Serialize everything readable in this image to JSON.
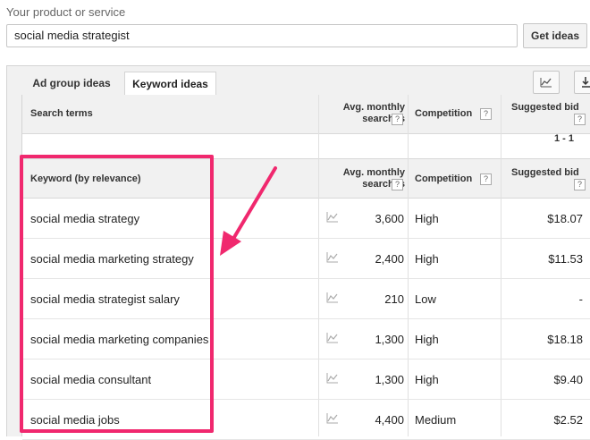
{
  "form": {
    "label": "Your product or service",
    "search_value": "social media strategist",
    "button": "Get ideas"
  },
  "tabs": [
    {
      "label": "Ad group ideas",
      "active": false
    },
    {
      "label": "Keyword ideas",
      "active": true
    }
  ],
  "search_terms_header": {
    "col_term": "Search terms",
    "col_searches": "Avg. monthly searches",
    "col_competition": "Competition",
    "col_bid": "Suggested bid",
    "pager": "1 - 1"
  },
  "keywords_header": {
    "col_term": "Keyword (by relevance)",
    "col_searches": "Avg. monthly searches",
    "col_competition": "Competition",
    "col_bid": "Suggested bid"
  },
  "help_glyph": "?",
  "rows": [
    {
      "keyword": "social media strategy",
      "searches": "3,600",
      "competition": "High",
      "bid": "$18.07"
    },
    {
      "keyword": "social media marketing strategy",
      "searches": "2,400",
      "competition": "High",
      "bid": "$11.53"
    },
    {
      "keyword": "social media strategist salary",
      "searches": "210",
      "competition": "Low",
      "bid": "-"
    },
    {
      "keyword": "social media marketing companies",
      "searches": "1,300",
      "competition": "High",
      "bid": "$18.18"
    },
    {
      "keyword": "social media consultant",
      "searches": "1,300",
      "competition": "High",
      "bid": "$9.40"
    },
    {
      "keyword": "social media jobs",
      "searches": "4,400",
      "competition": "Medium",
      "bid": "$2.52"
    }
  ],
  "colors": {
    "highlight": "#f0286e",
    "header_bg": "#f1f1f1"
  }
}
